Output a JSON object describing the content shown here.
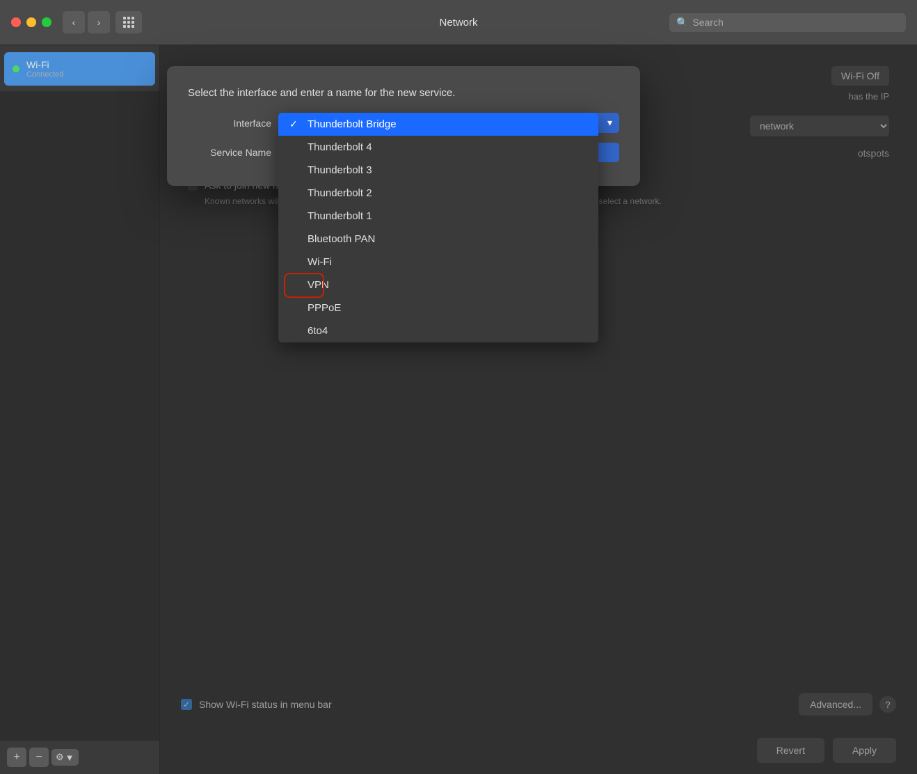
{
  "titlebar": {
    "title": "Network",
    "search_placeholder": "Search"
  },
  "sidebar": {
    "items": [
      {
        "name": "Wi-Fi",
        "status": "Connected",
        "status_type": "connected"
      }
    ]
  },
  "dialog": {
    "title": "Select the interface and enter a name for the new service.",
    "interface_label": "Interface",
    "service_name_label": "Service Name",
    "selected_interface": "Thunderbolt Bridge",
    "dropdown_items": [
      {
        "label": "Thunderbolt Bridge",
        "selected": true
      },
      {
        "label": "Thunderbolt 4",
        "selected": false
      },
      {
        "label": "Thunderbolt 3",
        "selected": false
      },
      {
        "label": "Thunderbolt 2",
        "selected": false
      },
      {
        "label": "Thunderbolt 1",
        "selected": false
      },
      {
        "label": "Bluetooth PAN",
        "selected": false
      },
      {
        "label": "Wi-Fi",
        "selected": false
      },
      {
        "label": "VPN",
        "selected": false,
        "highlight": true
      },
      {
        "label": "PPPoE",
        "selected": false
      },
      {
        "label": "6to4",
        "selected": false
      }
    ]
  },
  "right_panel": {
    "wifi_off_btn": "Wi-Fi Off",
    "ip_text": "has the IP",
    "network_label": "network",
    "hotspots_label": "otspots",
    "ask_join_title": "Ask to join new networks",
    "ask_join_desc": "Known networks will be joined automatically. If no known networks are available, you will have to manually select a network."
  },
  "bottom_bar": {
    "show_wifi_label": "Show Wi-Fi status in menu bar",
    "advanced_btn": "Advanced...",
    "help_symbol": "?"
  },
  "action_buttons": {
    "revert_label": "Revert",
    "apply_label": "Apply"
  }
}
